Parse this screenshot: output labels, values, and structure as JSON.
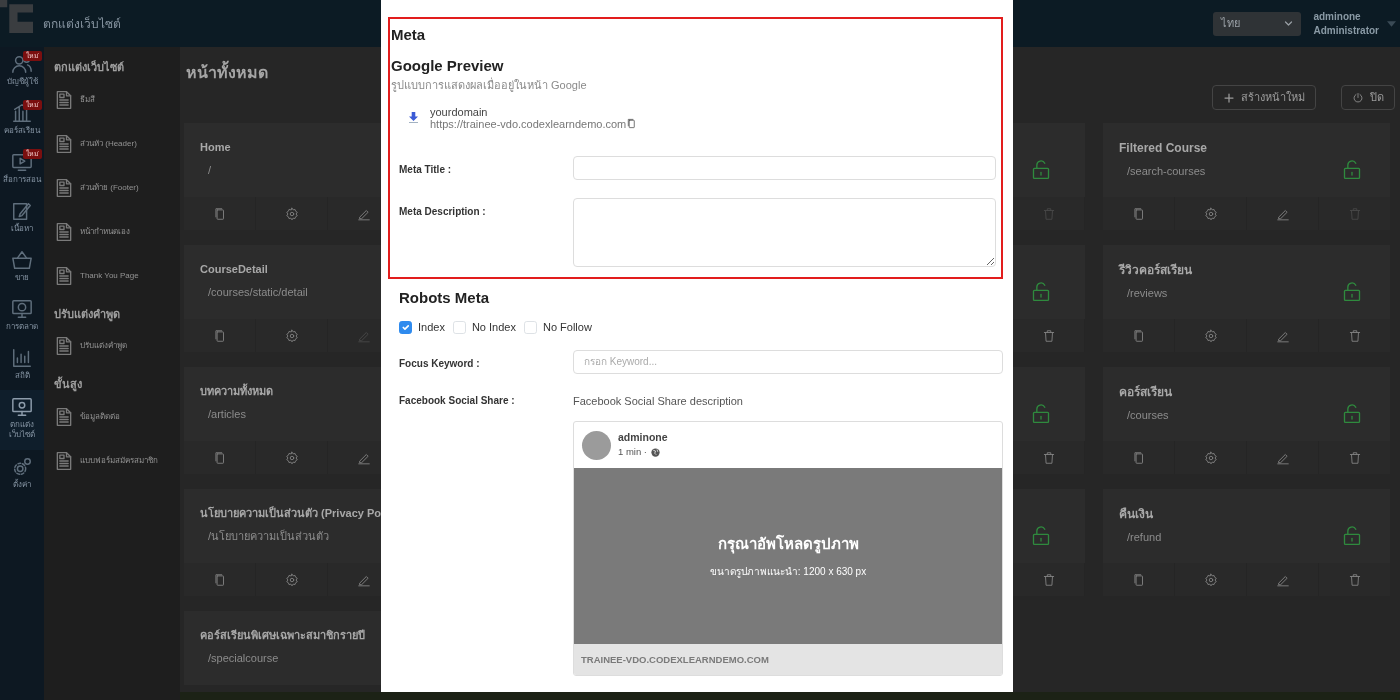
{
  "top_bar": {
    "title": "ตกแต่งเว็บไซต์",
    "language": "ไทย",
    "user_name": "adminone",
    "user_role": "Administrator"
  },
  "rail": [
    {
      "kind": "users",
      "label": "บัญชีผู้ใช้",
      "badge": "ใหม่",
      "selected": false
    },
    {
      "kind": "courses",
      "label": "คอร์สเรียน",
      "badge": "ใหม่",
      "selected": false
    },
    {
      "kind": "media",
      "label": "สื่อการสอน",
      "badge": "ใหม่",
      "selected": false
    },
    {
      "kind": "content",
      "label": "เนื้อหา",
      "selected": false
    },
    {
      "kind": "sales",
      "label": "ขาย",
      "selected": false
    },
    {
      "kind": "marketing",
      "label": "การตลาด",
      "selected": false
    },
    {
      "kind": "stats",
      "label": "สถิติ",
      "selected": false
    },
    {
      "kind": "design",
      "label": "ตกแต่งเว็บไซต์",
      "selected": true
    },
    {
      "kind": "settings",
      "label": "ตั้งค่า",
      "selected": false
    }
  ],
  "sidebar": [
    {
      "heading": "ตกแต่งเว็บไซต์",
      "items": [
        "ธีมสี",
        "ส่วนหัว (Header)",
        "ส่วนท้าย (Footer)",
        "หน้ากำหนดเอง",
        "Thank You Page"
      ]
    },
    {
      "heading": "ปรับแต่งคำพูด",
      "items": [
        "ปรับแต่งคำพูด"
      ]
    },
    {
      "heading": "ขั้นสูง",
      "items": [
        "ข้อมูลติดต่อ",
        "แบบฟอร์มสมัครสมาชิก"
      ]
    }
  ],
  "page": {
    "title": "หน้าทั้งหมด",
    "buttons": [
      {
        "kind": "create",
        "label": "สร้างหน้าใหม่"
      },
      {
        "kind": "close",
        "label": "ปิด"
      }
    ]
  },
  "cards_left": [
    {
      "title": "Home",
      "path": "/",
      "actions": [
        {
          "kind": "copy",
          "disabled": false
        },
        {
          "kind": "settings",
          "disabled": false
        },
        {
          "kind": "edit",
          "disabled": false
        }
      ]
    },
    {
      "title": "CourseDetail",
      "path": "/courses/static/detail",
      "actions": [
        {
          "kind": "copy",
          "disabled": false
        },
        {
          "kind": "settings",
          "disabled": false
        },
        {
          "kind": "edit",
          "disabled": true
        }
      ]
    },
    {
      "title": "บทความทั้งหมด",
      "path": "/articles",
      "actions": [
        {
          "kind": "copy",
          "disabled": false
        },
        {
          "kind": "settings",
          "disabled": false
        },
        {
          "kind": "edit",
          "disabled": false
        }
      ]
    },
    {
      "title": "นโยบายความเป็นส่วนตัว (Privacy Po",
      "path": "/นโยบายความเป็นส่วนตัว",
      "actions": [
        {
          "kind": "copy",
          "disabled": false
        },
        {
          "kind": "settings",
          "disabled": false
        },
        {
          "kind": "edit",
          "disabled": false
        }
      ]
    },
    {
      "title": "คอร์สเรียนพิเศษเฉพาะสมาชิกรายปี",
      "path": "/specialcourse"
    }
  ],
  "cards_middle": [
    {
      "actions": [
        {
          "kind": "delete",
          "disabled": true
        }
      ]
    },
    {
      "actions": [
        {
          "kind": "delete",
          "disabled": false
        }
      ]
    },
    {
      "actions": [
        {
          "kind": "delete",
          "disabled": false
        }
      ]
    },
    {
      "actions": [
        {
          "kind": "delete",
          "disabled": false
        }
      ]
    }
  ],
  "cards_right": [
    {
      "title": "Filtered Course",
      "path": "/search-courses",
      "actions": [
        {
          "kind": "copy",
          "disabled": false
        },
        {
          "kind": "settings",
          "disabled": false
        },
        {
          "kind": "edit",
          "disabled": false
        },
        {
          "kind": "delete",
          "disabled": true
        }
      ]
    },
    {
      "title": "รีวิวคอร์สเรียน",
      "path": "/reviews",
      "actions": [
        {
          "kind": "copy",
          "disabled": false
        },
        {
          "kind": "settings",
          "disabled": false
        },
        {
          "kind": "edit",
          "disabled": false
        },
        {
          "kind": "delete",
          "disabled": false
        }
      ]
    },
    {
      "title": "คอร์สเรียน",
      "path": "/courses",
      "actions": [
        {
          "kind": "copy",
          "disabled": false
        },
        {
          "kind": "settings",
          "disabled": false
        },
        {
          "kind": "edit",
          "disabled": false
        },
        {
          "kind": "delete",
          "disabled": false
        }
      ]
    },
    {
      "title": "คืนเงิน",
      "path": "/refund",
      "actions": [
        {
          "kind": "copy",
          "disabled": false
        },
        {
          "kind": "settings",
          "disabled": false
        },
        {
          "kind": "edit",
          "disabled": false
        },
        {
          "kind": "delete",
          "disabled": false
        }
      ]
    }
  ],
  "modal": {
    "section_title": "Meta",
    "google_preview": {
      "title": "Google Preview",
      "subtitle": "รูปแบบการแสดงผลเมื่ออยู่ในหน้า Google",
      "site_name": "yourdomain",
      "url": "https://trainee-vdo.codexlearndemo.com"
    },
    "fields": [
      {
        "kind": "input",
        "label": "Meta Title :"
      },
      {
        "kind": "textarea",
        "label": "Meta Description :"
      }
    ],
    "robots": {
      "title": "Robots Meta",
      "options": [
        {
          "label": "Index",
          "checked": true
        },
        {
          "label": "No Index",
          "checked": false
        },
        {
          "label": "No Follow",
          "checked": false
        }
      ]
    },
    "focus_keyword": {
      "label": "Focus Keyword :",
      "placeholder": "กรอก Keyword..."
    },
    "facebook": {
      "label": "Facebook Social Share :",
      "description": "Facebook Social Share description",
      "author": "adminone",
      "time": "1 min ·",
      "upload_title": "กรุณาอัพโหลดรูปภาพ",
      "upload_hint": "ขนาดรูปภาพแนะนำ: 1200 x 630 px",
      "domain": "TRAINEE-VDO.CODEXLEARNDEMO.COM"
    }
  }
}
